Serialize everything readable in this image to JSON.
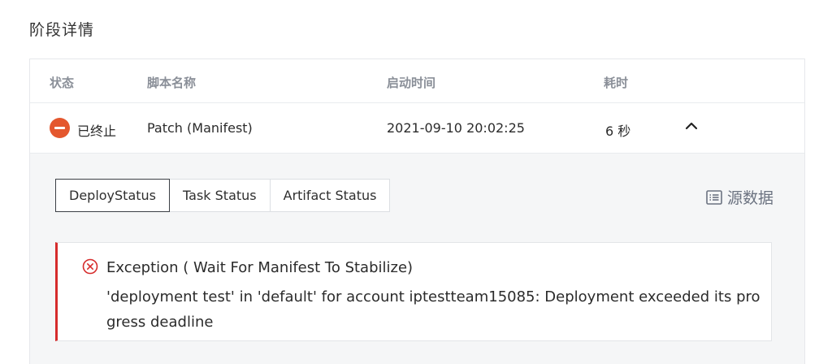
{
  "section": {
    "title": "阶段详情"
  },
  "table": {
    "headers": {
      "status": "状态",
      "script_name": "脚本名称",
      "start_time": "启动时间",
      "duration": "耗时"
    },
    "row": {
      "status_label": "已终止",
      "script_name": "Patch (Manifest)",
      "start_time": "2021-09-10 20:02:25",
      "duration": "6 秒",
      "status_icon": "stop-circle-icon",
      "status_color": "#e4572e"
    }
  },
  "detail": {
    "tabs": [
      {
        "label": "DeployStatus",
        "active": true
      },
      {
        "label": "Task Status",
        "active": false
      },
      {
        "label": "Artifact Status",
        "active": false
      }
    ],
    "raw_data_label": "源数据",
    "error": {
      "title": "Exception ( Wait For Manifest To Stabilize)",
      "message": "'deployment test' in 'default' for account iptestteam15085: Deployment exceeded its progress deadline",
      "accent_color": "#d62c2c"
    }
  }
}
